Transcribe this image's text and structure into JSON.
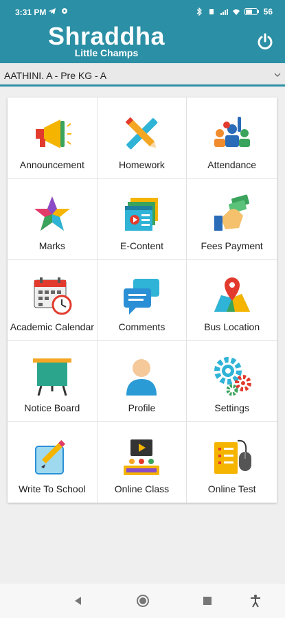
{
  "status_bar": {
    "time": "3:31 PM",
    "battery": "56"
  },
  "header": {
    "title": "Shraddha",
    "subtitle": "Little Champs"
  },
  "selector": {
    "value": "AATHINI. A - Pre KG - A"
  },
  "tiles": [
    {
      "label": "Announcement",
      "icon": "megaphone-icon"
    },
    {
      "label": "Homework",
      "icon": "pencil-ruler-icon"
    },
    {
      "label": "Attendance",
      "icon": "students-hand-raise-icon"
    },
    {
      "label": "Marks",
      "icon": "star-icon"
    },
    {
      "label": "E-Content",
      "icon": "video-content-icon"
    },
    {
      "label": "Fees Payment",
      "icon": "hand-money-icon"
    },
    {
      "label": "Academic Calendar",
      "icon": "calendar-clock-icon"
    },
    {
      "label": "Comments",
      "icon": "chat-bubbles-icon"
    },
    {
      "label": "Bus Location",
      "icon": "map-pin-icon"
    },
    {
      "label": "Notice Board",
      "icon": "notice-board-icon"
    },
    {
      "label": "Profile",
      "icon": "user-avatar-icon"
    },
    {
      "label": "Settings",
      "icon": "gears-icon"
    },
    {
      "label": "Write To School",
      "icon": "write-note-icon"
    },
    {
      "label": "Online Class",
      "icon": "online-class-icon"
    },
    {
      "label": "Online Test",
      "icon": "test-mouse-icon"
    }
  ],
  "colors": {
    "header": "#2b8fa5",
    "background": "#efefef"
  }
}
